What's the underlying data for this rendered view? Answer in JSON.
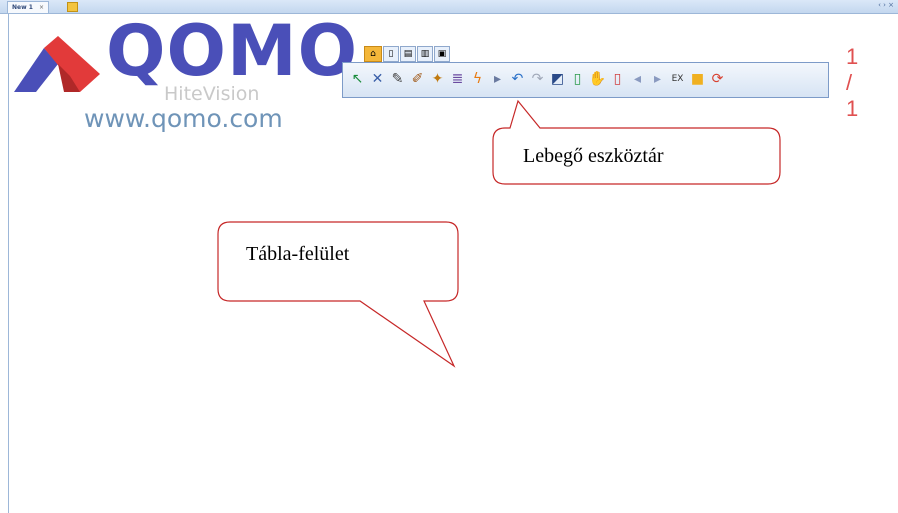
{
  "tabbar": {
    "tab_label": "New 1",
    "tab_close": "×",
    "scroll": "‹ › ×"
  },
  "logo": {
    "brand": "QOMO",
    "sub": "HiteVision",
    "url": "www.qomo.com"
  },
  "toolbar": {
    "tabs": [
      {
        "name": "home-icon",
        "glyph": "⌂"
      },
      {
        "name": "page-icon",
        "glyph": "▯"
      },
      {
        "name": "folder-icon",
        "glyph": "▤"
      },
      {
        "name": "book-icon",
        "glyph": "▥"
      },
      {
        "name": "media-icon",
        "glyph": "▣"
      }
    ],
    "tools": [
      {
        "name": "select-arrow-icon",
        "glyph": "↖",
        "color": "#1a8c3c"
      },
      {
        "name": "lasso-select-icon",
        "glyph": "✕",
        "color": "#3a5fa8"
      },
      {
        "name": "pen-icon",
        "glyph": "✎",
        "color": "#444444"
      },
      {
        "name": "brush-icon",
        "glyph": "✐",
        "color": "#a05a1a"
      },
      {
        "name": "magic-pen-icon",
        "glyph": "✦",
        "color": "#c07a10"
      },
      {
        "name": "handwriting-icon",
        "glyph": "≣",
        "color": "#6a4aa0"
      },
      {
        "name": "laser-icon",
        "glyph": "ϟ",
        "color": "#e87a10"
      },
      {
        "name": "page-arrow-icon",
        "glyph": "▸",
        "color": "#6a7aa0"
      },
      {
        "name": "undo-icon",
        "glyph": "↶",
        "color": "#2a70c8"
      },
      {
        "name": "redo-icon",
        "glyph": "↷",
        "color": "#a0a8b8"
      },
      {
        "name": "edit-box-icon",
        "glyph": "◩",
        "color": "#2a4a88"
      },
      {
        "name": "new-page-icon",
        "glyph": "▯",
        "color": "#2a9a4a"
      },
      {
        "name": "hand-icon",
        "glyph": "✋",
        "color": "#d49a20"
      },
      {
        "name": "delete-page-icon",
        "glyph": "▯",
        "color": "#d04040"
      },
      {
        "name": "prev-page-icon",
        "glyph": "◂",
        "color": "#8a9ac0"
      },
      {
        "name": "next-page-icon",
        "glyph": "▸",
        "color": "#8a9ac0"
      },
      {
        "name": "exit-icon",
        "glyph": "EX",
        "color": "#333333"
      },
      {
        "name": "folder-icon",
        "glyph": "■",
        "color": "#f0b020"
      },
      {
        "name": "refresh-icon",
        "glyph": "⟳",
        "color": "#d84030"
      }
    ]
  },
  "page_number": "1 / 1",
  "callouts": {
    "toolbar": "Lebegő eszköztár",
    "board": "Tábla-felület"
  }
}
